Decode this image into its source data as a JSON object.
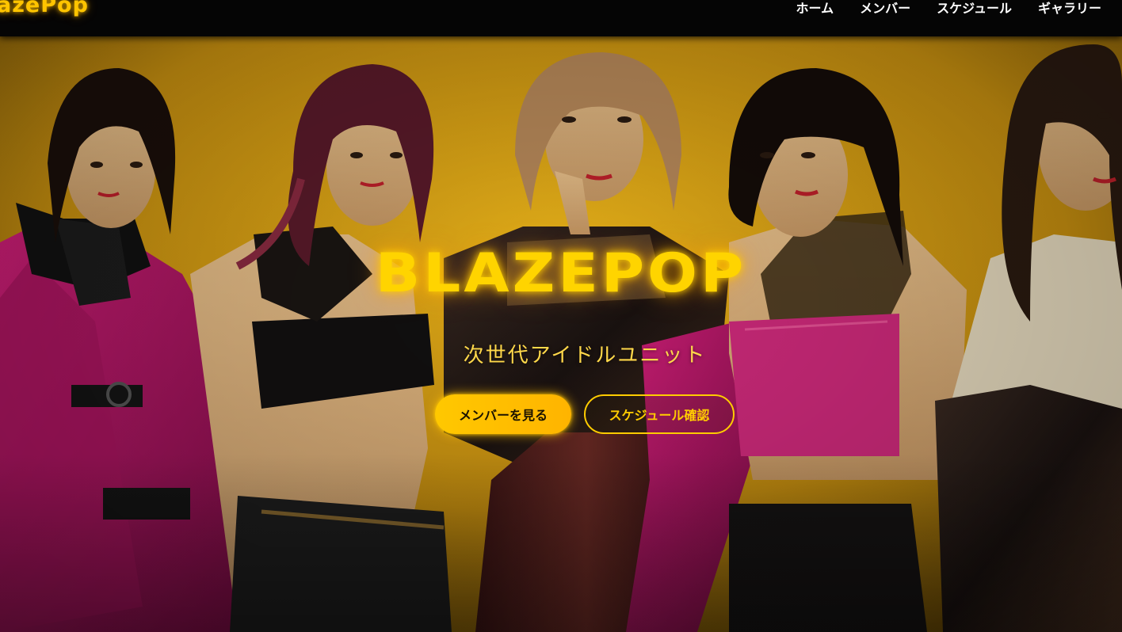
{
  "header": {
    "logo_text": "azePop",
    "nav": [
      {
        "label": "ホーム"
      },
      {
        "label": "メンバー"
      },
      {
        "label": "スケジュール"
      },
      {
        "label": "ギャラリー"
      }
    ]
  },
  "hero": {
    "title": "BLAZEPOP",
    "subtitle": "次世代アイドルユニット",
    "primary_button": "メンバーを見る",
    "secondary_button": "スケジュール確認",
    "image": "group-photo"
  },
  "colors": {
    "accent": "#ffc400",
    "header_bg": "#050505",
    "backdrop": "#e0a810",
    "outfit_magenta": "#c0186a",
    "outfit_black": "#141414"
  }
}
